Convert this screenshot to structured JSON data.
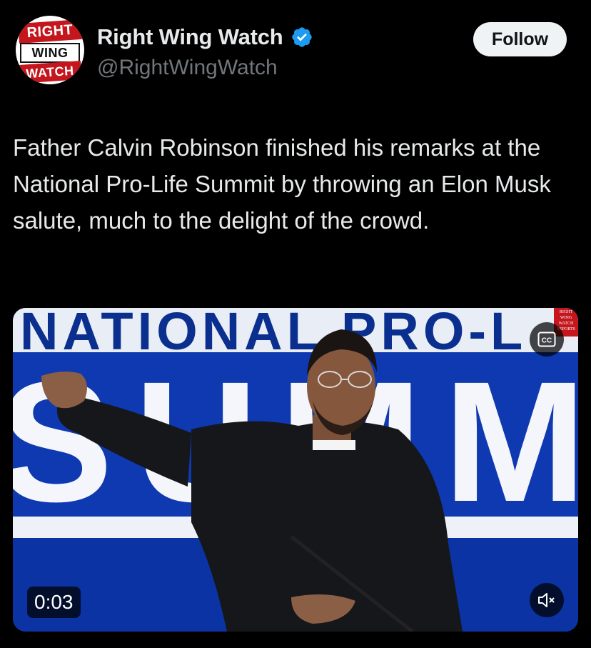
{
  "account": {
    "display_name": "Right Wing Watch",
    "handle": "@RightWingWatch",
    "avatar_logo": {
      "line1": "RIGHT",
      "line2": "WING",
      "line3": "WATCH"
    },
    "verified": true,
    "verified_color": "#1d9bf0"
  },
  "actions": {
    "follow_label": "Follow"
  },
  "tweet": {
    "text": "Father Calvin Robinson finished his remarks at the National Pro-Life Summit by throwing an Elon Musk salute, much to the delight of the crowd."
  },
  "video": {
    "timestamp": "0:03",
    "captions_label": "CC",
    "stage_sign_top": "NATIONAL PRO-L",
    "stage_sign_big": "SUMM",
    "watermark": "RIGHT WING WATCH REPORTS",
    "icons": [
      "closed-captions-icon",
      "volume-muted-icon"
    ]
  },
  "colors": {
    "background": "#000000",
    "primary_text": "#e7e9ea",
    "secondary_text": "#71767b",
    "follow_bg": "#eff3f4",
    "brand_red": "#c4161c"
  }
}
